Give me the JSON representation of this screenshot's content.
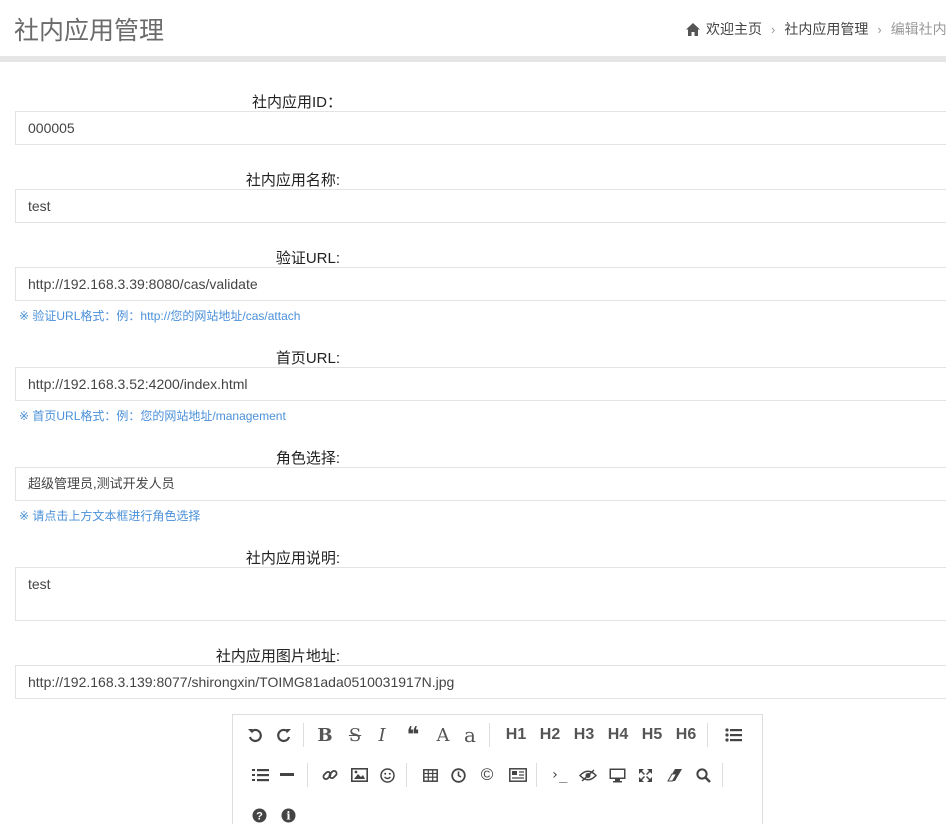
{
  "header": {
    "title": "社内应用管理",
    "breadcrumb": [
      {
        "label": "欢迎主页"
      },
      {
        "label": "社内应用管理"
      },
      {
        "label": "编辑社内"
      }
    ]
  },
  "form": {
    "app_id": {
      "label": "社内应用ID：",
      "value": "000005"
    },
    "app_name": {
      "label": "社内应用名称:",
      "value": "test"
    },
    "validate_url": {
      "label": "验证URL:",
      "value": "http://192.168.3.39:8080/cas/validate",
      "help": "※ 验证URL格式：例：http://您的网站地址/cas/attach"
    },
    "home_url": {
      "label": "首页URL:",
      "value": "http://192.168.3.52:4200/index.html",
      "help": "※ 首页URL格式：例：您的网站地址/management"
    },
    "role": {
      "label": "角色选择:",
      "value": "超级管理员,测试开发人员",
      "help": "※ 请点击上方文本框进行角色选择"
    },
    "description": {
      "label": "社内应用说明:",
      "value": "test"
    },
    "image_url": {
      "label": "社内应用图片地址:",
      "value": "http://192.168.3.139:8077/shirongxin/TOIMG81ada0510031917N.jpg"
    }
  },
  "toolbar": {
    "bold": "B",
    "strike": "S",
    "italic": "I",
    "quote": "❝",
    "uppercase": "A",
    "lowercase": "a",
    "h1": "H1",
    "h2": "H2",
    "h3": "H3",
    "h4": "H4",
    "h5": "H5",
    "h6": "H6",
    "code": "›_",
    "icons": [
      "undo-icon",
      "redo-icon",
      "bold-icon",
      "strikethrough-icon",
      "italic-icon",
      "quote-icon",
      "uppercase-icon",
      "lowercase-icon",
      "h1-icon",
      "h2-icon",
      "h3-icon",
      "h4-icon",
      "h5-icon",
      "h6-icon",
      "unordered-list-icon",
      "ordered-list-icon",
      "horizontal-rule-icon",
      "link-icon",
      "image-icon",
      "emoji-icon",
      "table-icon",
      "datetime-icon",
      "copyright-icon",
      "pagebreak-icon",
      "code-icon",
      "preview-icon",
      "watch-icon",
      "fullscreen-icon",
      "clear-icon",
      "search-icon",
      "help-icon",
      "info-icon"
    ]
  },
  "colors": {
    "help_text": "#4a90d9",
    "border": "#e3e3e3",
    "header_bar": "#e6e6e6"
  }
}
